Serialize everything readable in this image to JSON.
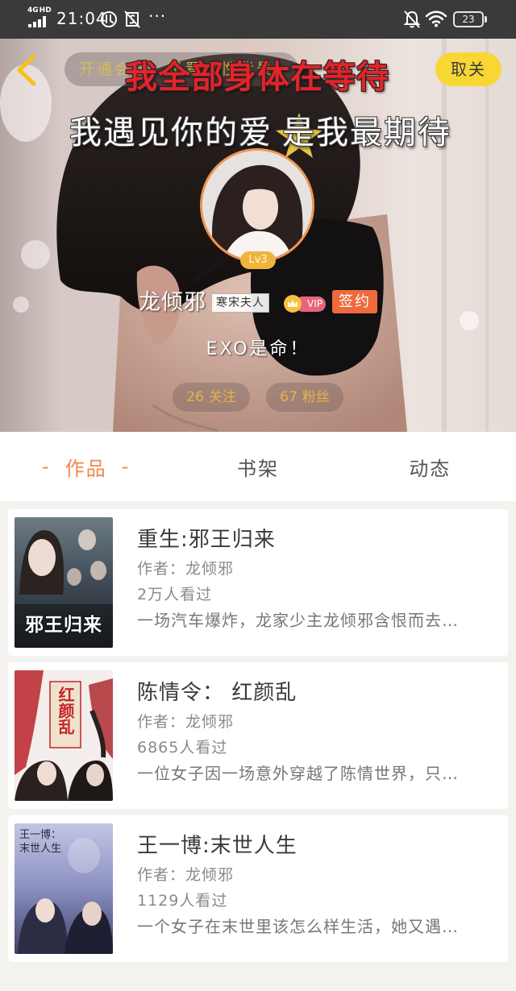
{
  "status_bar": {
    "network_type": "4G",
    "network_hd": "HD",
    "time": "21:04",
    "more_indicator": "···",
    "battery_level": "23",
    "icons": [
      "signal-icon",
      "notification-icon",
      "screenshot-icon",
      "mute-icon",
      "wifi-icon",
      "battery-icon"
    ]
  },
  "header": {
    "back_icon": "back-arrow-icon",
    "member_hint": "开通会员，设置个性背景",
    "background_text_red": "我全部身体在等待",
    "background_text_white_1": "我遇见你的爱",
    "background_text_white_2": "是我最期待",
    "unfollow_label": "取关"
  },
  "profile": {
    "level": "Lv3",
    "username": "龙倾邪",
    "title_badge": "寒宋夫人",
    "vip_label": "VIP",
    "signed_label": "签约",
    "signature": "EXO是命！",
    "following_count": "26",
    "following_label": "关注",
    "followers_count": "67",
    "followers_label": "粉丝"
  },
  "tabs": {
    "active_marker": "-",
    "items": [
      {
        "label": "作品",
        "active": true
      },
      {
        "label": "书架",
        "active": false
      },
      {
        "label": "动态",
        "active": false
      }
    ]
  },
  "labels": {
    "author_prefix": "作者：",
    "views_suffix": "人看过"
  },
  "works": [
    {
      "title": "重生:邪王归来",
      "author": "龙倾邪",
      "views": "2万",
      "description": "一场汽车爆炸，龙家少主龙倾邪含恨而去…",
      "cover_title": "邪王归来"
    },
    {
      "title": "陈情令： 红颜乱",
      "author": "龙倾邪",
      "views": "6865",
      "description": "一位女子因一场意外穿越了陈情世界，只…",
      "cover_title": "红颜乱"
    },
    {
      "title": "王一博:末世人生",
      "author": "龙倾邪",
      "views": "1129",
      "description": "一个女子在末世里该怎么样生活，她又遇…",
      "cover_title": "王一博：末世人生"
    }
  ],
  "colors": {
    "accent": "#f0874a",
    "unfollow_button": "#f8d633",
    "signed_badge": "#ee6a3c",
    "vip_badge": "#e8637b",
    "level_badge": "#f0b43c",
    "avatar_border": "#f09550",
    "back_arrow": "#f5c21c",
    "background_text_red": "#e3232a"
  }
}
